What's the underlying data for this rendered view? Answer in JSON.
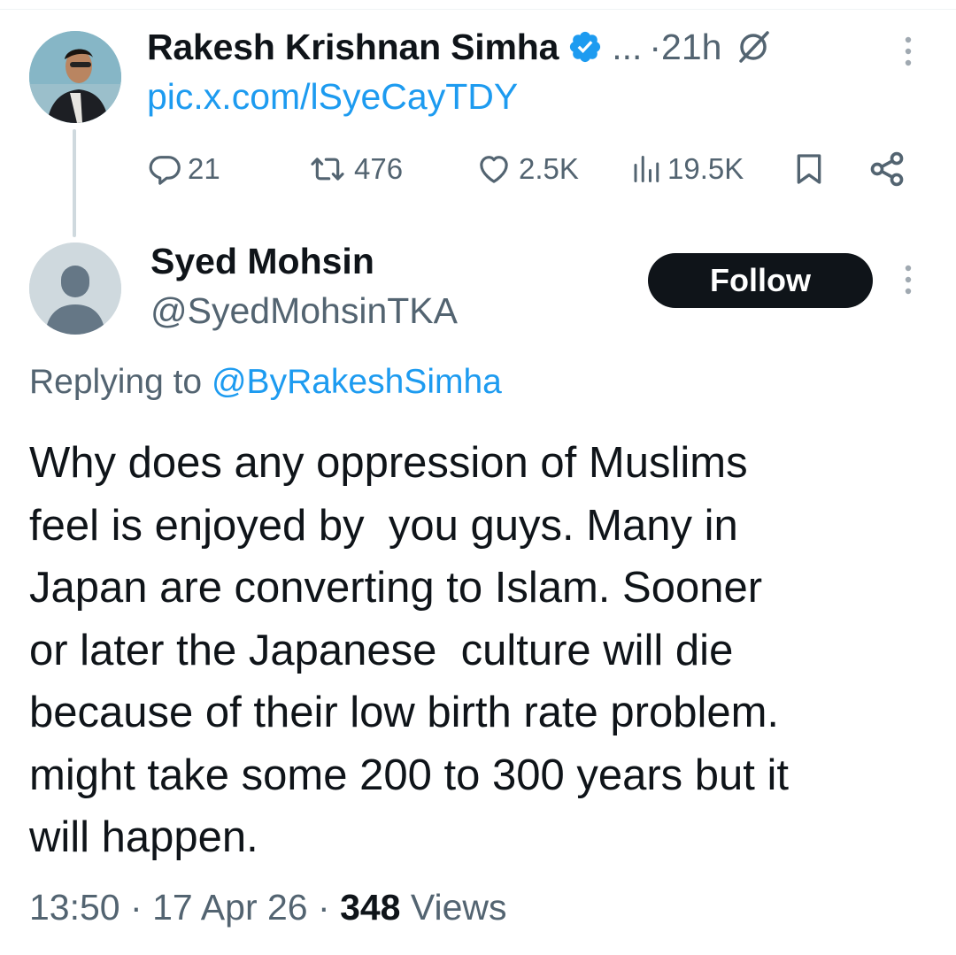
{
  "parent_tweet": {
    "author_name": "Rakesh Krishnan Simha",
    "ellipsis": "...",
    "separator": "·",
    "time": "21h",
    "link_text": "pic.x.com/lSyeCayTDY",
    "actions": {
      "replies": "21",
      "reposts": "476",
      "likes": "2.5K",
      "views": "19.5K"
    },
    "icons": [
      "verified-badge-icon",
      "grok-icon",
      "more-icon",
      "reply-icon",
      "repost-icon",
      "like-icon",
      "views-icon",
      "bookmark-icon",
      "share-icon"
    ]
  },
  "reply_tweet": {
    "author_name": "Syed Mohsin",
    "handle": "@SyedMohsinTKA",
    "follow_label": "Follow",
    "replying_prefix": "Replying to",
    "replying_to": "@ByRakeshSimha",
    "text": "Why does any oppression of Muslims\nfeel is enjoyed by  you guys. Many in\nJapan are converting to Islam. Sooner\nor later the Japanese  culture will die\nbecause of their low birth rate problem.\nmight take some 200 to 300 years but it\nwill happen.",
    "time": "13:50",
    "sep1": "·",
    "date": "17 Apr 26",
    "sep2": "·",
    "views_count": "348",
    "views_label": "Views"
  },
  "colors": {
    "text_primary": "#0f1419",
    "text_secondary": "#536471",
    "accent": "#1d9bf0",
    "thread_line": "#cfd9de",
    "follow_button_bg": "#0f1419"
  }
}
